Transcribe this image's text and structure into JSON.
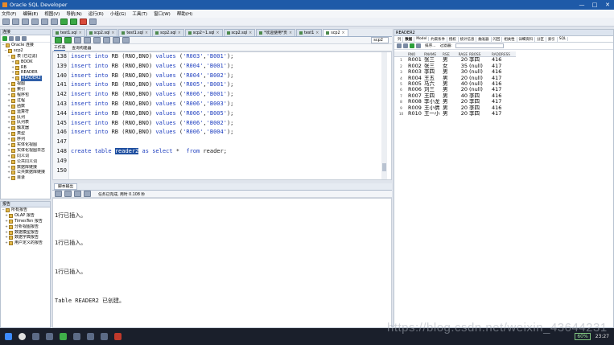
{
  "window": {
    "title": "Oracle SQL Developer",
    "controls": [
      "—",
      "□",
      "✕"
    ]
  },
  "menu": [
    "文件(F)",
    "编辑(E)",
    "视图(V)",
    "导航(N)",
    "运行(R)",
    "小组(G)",
    "工具(T)",
    "窗口(W)",
    "帮助(H)"
  ],
  "connections": {
    "title": "连接",
    "tree": [
      {
        "label": "Oracle 连接",
        "expand": "−",
        "sel": false
      },
      {
        "label": "scp2",
        "expand": "−",
        "sel": false
      },
      {
        "label": "表 (已过滤)",
        "expand": "−",
        "sel": false
      },
      {
        "label": "BOOK",
        "expand": "+",
        "sel": false
      },
      {
        "label": "RB",
        "expand": "+",
        "sel": false
      },
      {
        "label": "READER",
        "expand": "+",
        "sel": false
      },
      {
        "label": "READER2",
        "expand": "+",
        "sel": true
      },
      {
        "label": "视图",
        "expand": "+",
        "sel": false
      },
      {
        "label": "索引",
        "expand": "+",
        "sel": false
      },
      {
        "label": "程序包",
        "expand": "+",
        "sel": false
      },
      {
        "label": "过程",
        "expand": "+",
        "sel": false
      },
      {
        "label": "函数",
        "expand": "+",
        "sel": false
      },
      {
        "label": "运算符",
        "expand": "+",
        "sel": false
      },
      {
        "label": "队列",
        "expand": "+",
        "sel": false
      },
      {
        "label": "队列表",
        "expand": "+",
        "sel": false
      },
      {
        "label": "触发器",
        "expand": "+",
        "sel": false
      },
      {
        "label": "类型",
        "expand": "+",
        "sel": false
      },
      {
        "label": "序列",
        "expand": "+",
        "sel": false
      },
      {
        "label": "实体化视图",
        "expand": "+",
        "sel": false
      },
      {
        "label": "实体化视图日志",
        "expand": "+",
        "sel": false
      },
      {
        "label": "同义词",
        "expand": "+",
        "sel": false
      },
      {
        "label": "公共同义词",
        "expand": "+",
        "sel": false
      },
      {
        "label": "数据库链接",
        "expand": "+",
        "sel": false
      },
      {
        "label": "公共数据库链接",
        "expand": "+",
        "sel": false
      },
      {
        "label": "目录",
        "expand": "+",
        "sel": false
      }
    ]
  },
  "reports": {
    "title": "报告",
    "tree": [
      {
        "label": "所有报告",
        "expand": "−"
      },
      {
        "label": "OLAP 报告",
        "expand": "+"
      },
      {
        "label": "TimesTen 报告",
        "expand": "+"
      },
      {
        "label": "分析视图报告",
        "expand": "+"
      },
      {
        "label": "数据模型报告",
        "expand": "+"
      },
      {
        "label": "数据字典报告",
        "expand": "+"
      },
      {
        "label": "用户定义的报告",
        "expand": "+"
      }
    ]
  },
  "editor_tabs": [
    {
      "label": "test1.sql",
      "active": false
    },
    {
      "label": "scp2.sql",
      "active": false
    },
    {
      "label": "test1.sql",
      "active": false
    },
    {
      "label": "scp2.sql",
      "active": false
    },
    {
      "label": "scp2~1.sql",
      "active": false
    },
    {
      "label": "scp2.sql",
      "active": false
    },
    {
      "label": "*欢迎使用*页",
      "active": false
    },
    {
      "label": "test1",
      "active": false
    },
    {
      "label": "scp2",
      "active": true
    }
  ],
  "connection_select": "scp2",
  "subtabs": [
    "工作表",
    "查询构建器"
  ],
  "code_lines": [
    {
      "no": "138",
      "code": "insert into RB (RNO,BNO) values ('R003','B001');"
    },
    {
      "no": "139",
      "code": "insert into RB (RNO,BNO) values ('R004','B001');"
    },
    {
      "no": "140",
      "code": "insert into RB (RNO,BNO) values ('R004','B002');"
    },
    {
      "no": "141",
      "code": "insert into RB (RNO,BNO) values ('R005','B001');"
    },
    {
      "no": "142",
      "code": "insert into RB (RNO,BNO) values ('R006','B001');"
    },
    {
      "no": "143",
      "code": "insert into RB (RNO,BNO) values ('R006','B003');"
    },
    {
      "no": "144",
      "code": "insert into RB (RNO,BNO) values ('R006','B005');"
    },
    {
      "no": "145",
      "code": "insert into RB (RNO,BNO) values ('R006','B002');"
    },
    {
      "no": "146",
      "code": "insert into RB (RNO,BNO) values ('R006','B004');"
    },
    {
      "no": "147",
      "code": ""
    },
    {
      "no": "148",
      "code": "create table reader2 as select *  from reader;"
    },
    {
      "no": "149",
      "code": ""
    },
    {
      "no": "150",
      "code": ""
    }
  ],
  "output": {
    "tab": "脚本输出",
    "status": "任务已完成, 用时 0.108 秒",
    "lines": [
      "1行已插入。",
      "1行已插入。",
      "1行已插入。",
      "Table READER2 已创建。"
    ]
  },
  "result": {
    "title": "READER2",
    "tabs": [
      "列",
      "数据",
      "Model",
      "约束条件",
      "授权",
      "统计信息",
      "触发器",
      "闪回",
      "相关性",
      "详细资料",
      "分区",
      "索引",
      "SQL"
    ],
    "active_tab": "数据",
    "actions": "排序...",
    "filter_label": "过滤器:",
    "columns": [
      "RNO",
      "RNAME",
      "RSEX",
      "RAGE",
      "RBOSS",
      "RADDRESS"
    ],
    "rows": [
      [
        "1",
        "R001",
        "张三",
        "男",
        "20",
        "李四",
        "416"
      ],
      [
        "2",
        "R002",
        "张三",
        "女",
        "35",
        "(null)",
        "417"
      ],
      [
        "3",
        "R003",
        "李四",
        "男",
        "30",
        "(null)",
        "416"
      ],
      [
        "4",
        "R004",
        "王五",
        "男",
        "20",
        "(null)",
        "417"
      ],
      [
        "5",
        "R005",
        "马六",
        "男",
        "40",
        "(null)",
        "416"
      ],
      [
        "6",
        "R006",
        "刘三",
        "男",
        "20",
        "(null)",
        "417"
      ],
      [
        "7",
        "R007",
        "王四",
        "男",
        "40",
        "李四",
        "416"
      ],
      [
        "8",
        "R008",
        "李小龙",
        "男",
        "20",
        "李四",
        "417"
      ],
      [
        "9",
        "R009",
        "王小倩",
        "男",
        "20",
        "李四",
        "416"
      ],
      [
        "10",
        "R010",
        "王一小",
        "男",
        "20",
        "李四",
        "417"
      ]
    ]
  },
  "taskbar": {
    "battery": "60%",
    "clock": "23:27"
  },
  "watermark": "https://blog.csdn.net/weixin_43644231"
}
